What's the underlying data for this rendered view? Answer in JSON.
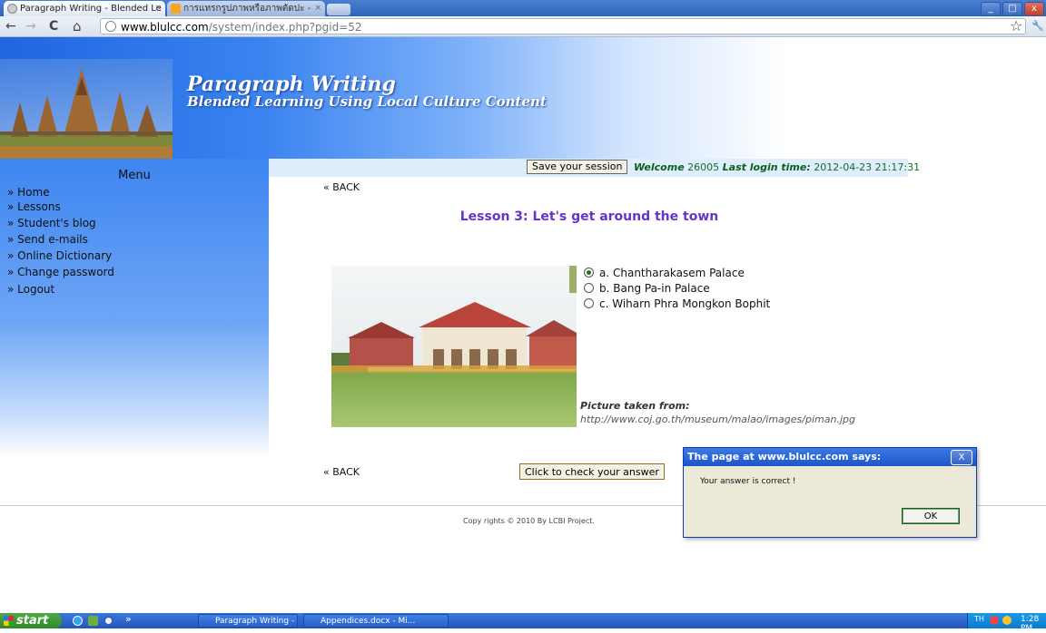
{
  "browser": {
    "tabs": [
      {
        "title": "Paragraph Writing - Blended Le",
        "close": "×"
      },
      {
        "title": "การแทรกรูปภาพหรือภาพตัดปะ -",
        "close": "×"
      }
    ],
    "url_domain": "www.blulcc.com",
    "url_path": "/system/index.php?pgid=52",
    "nav": {
      "back": "←",
      "forward": "→",
      "reload": "C",
      "home": "⌂",
      "star": "☆",
      "wrench": "🔧"
    },
    "window_buttons": {
      "minimize": "_",
      "maximize": "□",
      "close": "x"
    }
  },
  "site": {
    "title": "Paragraph Writing",
    "subtitle": "Blended Learning Using Local Culture Content"
  },
  "menu": {
    "title": "Menu",
    "items": [
      "» Home",
      "» Lessons",
      "» Student's blog",
      "» Send e-mails",
      "» Online Dictionary",
      "» Change password",
      "» Logout"
    ]
  },
  "session": {
    "save_label": "Save your session",
    "welcome_label": "Welcome",
    "user_id": "26005",
    "last_login_label": "Last login time:",
    "last_login_value": "2012-04-23 21:17:31"
  },
  "lesson": {
    "back_top": "« BACK",
    "back_bottom": "« BACK",
    "title": "Lesson 3: Let's get around the town",
    "options": [
      {
        "text": "a. Chantharakasem Palace",
        "selected": true
      },
      {
        "text": "b. Bang Pa-in Palace",
        "selected": false
      },
      {
        "text": "c. Wiharn Phra Mongkon Bophit",
        "selected": false
      }
    ],
    "picture_label": "Picture taken from:",
    "picture_url": "http://www.coj.go.th/museum/malao/images/piman.jpg",
    "check_label": "Click to check your answer"
  },
  "footer": {
    "copyright": "Copy rights © 2010 By LCBI Project."
  },
  "dialog": {
    "title": "The page at www.blulcc.com says:",
    "message": "Your answer is correct !",
    "ok_label": "OK",
    "close": "X"
  },
  "taskbar": {
    "start_label": "start",
    "tasks": [
      "Paragraph Writing - B...",
      "Appendices.docx - Mi..."
    ],
    "lang": "TH",
    "clock": "1:28 PM",
    "overflow": "»"
  },
  "colors": {
    "accent_purple": "#6633cc",
    "welcome_green": "#1b6a2a",
    "banner_blue": "#3a83f0"
  }
}
